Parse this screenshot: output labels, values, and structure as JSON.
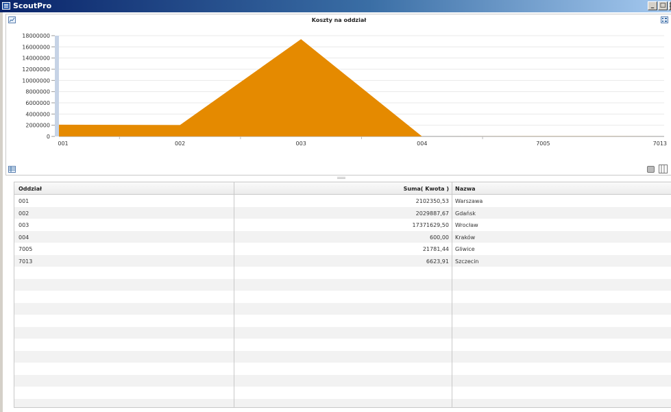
{
  "window": {
    "title": "ScoutPro",
    "buttons": [
      "_",
      "□",
      "×"
    ]
  },
  "chart_panel": {
    "icons": [
      "chart-settings-icon",
      "legend-icon",
      "table-view-icon",
      "print-icon",
      "columns-icon"
    ]
  },
  "chart_data": {
    "type": "area",
    "title": "Koszty na oddział",
    "categories": [
      "001",
      "002",
      "003",
      "004",
      "7005",
      "7013"
    ],
    "series": [
      {
        "values": [
          2102350.53,
          2029887.67,
          17371629.5,
          600.0,
          21781.44,
          6623.91
        ]
      }
    ],
    "ylim": [
      0,
      18000000
    ],
    "yticks": [
      "0",
      "2000000",
      "4000000",
      "6000000",
      "8000000",
      "10000000",
      "12000000",
      "14000000",
      "16000000",
      "18000000"
    ],
    "colors": {
      "area": "#e58a00",
      "gridline": "#e8e8e8",
      "scrollbar": "#c6d3e6"
    },
    "grid": true
  },
  "table": {
    "columns": [
      "Oddział",
      "Suma( Kwota )",
      "Nazwa"
    ],
    "rows": [
      [
        "001",
        "2102350,53",
        "Warszawa"
      ],
      [
        "002",
        "2029887,67",
        "Gdańsk"
      ],
      [
        "003",
        "17371629,50",
        "Wrocław"
      ],
      [
        "004",
        "600,00",
        "Kraków"
      ],
      [
        "7005",
        "21781,44",
        "Gliwice"
      ],
      [
        "7013",
        "6623,91",
        "Szczecin"
      ]
    ]
  }
}
